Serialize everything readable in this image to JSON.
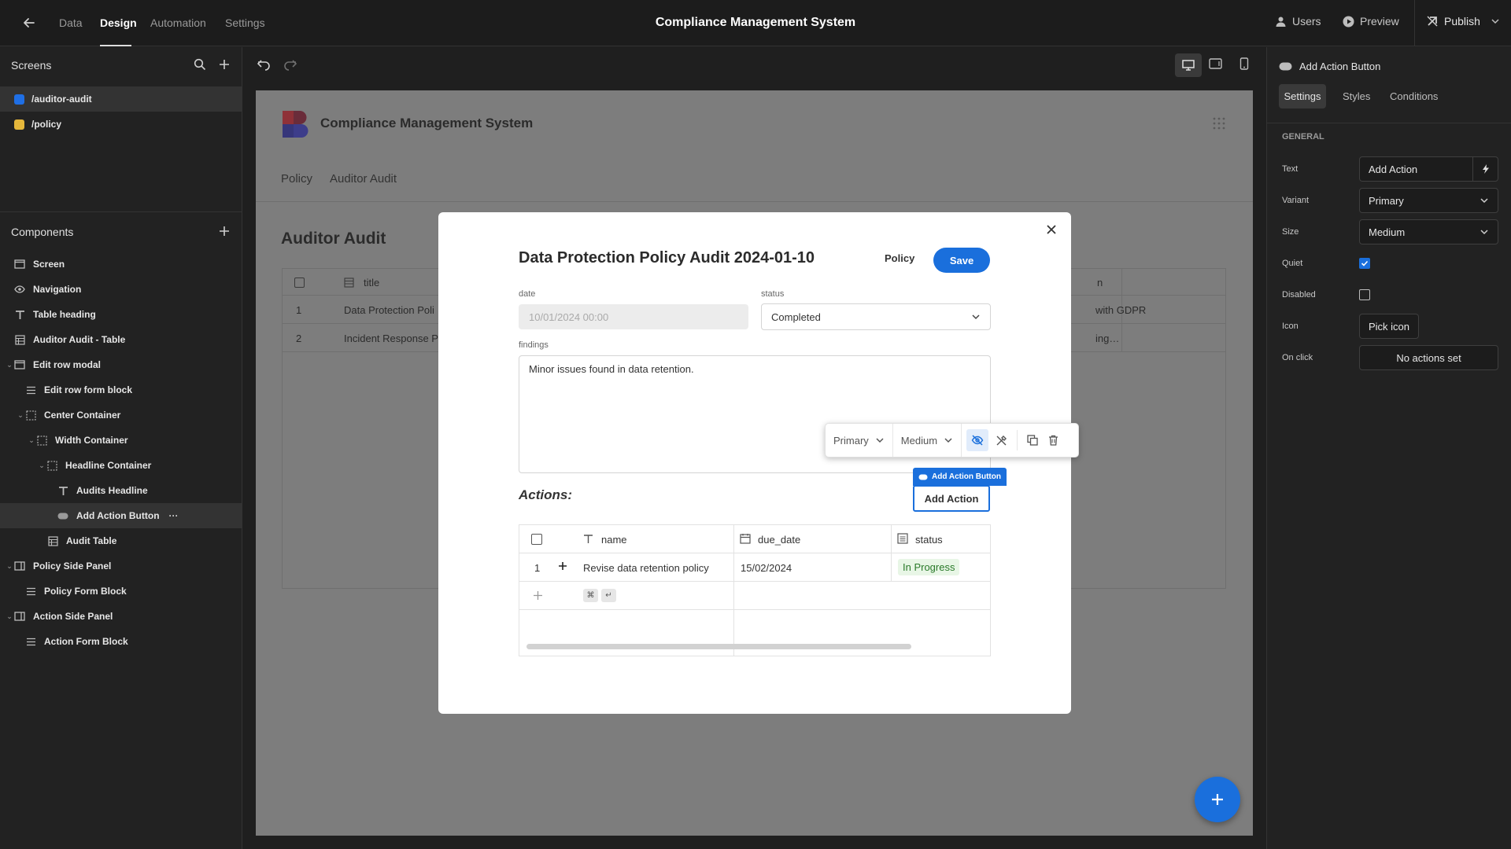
{
  "topbar": {
    "tabs": [
      {
        "label": "Data"
      },
      {
        "label": "Design"
      },
      {
        "label": "Automation"
      },
      {
        "label": "Settings"
      }
    ],
    "title": "Compliance Management System",
    "users_label": "Users",
    "preview_label": "Preview",
    "publish_label": "Publish"
  },
  "screens": {
    "header": "Screens",
    "items": [
      {
        "label": "/auditor-audit",
        "color": "#1f6fe5"
      },
      {
        "label": "/policy",
        "color": "#e5b73b"
      }
    ]
  },
  "components": {
    "header": "Components",
    "items": [
      {
        "label": "Screen",
        "icon": "screen-icon"
      },
      {
        "label": "Navigation",
        "icon": "eye-icon"
      },
      {
        "label": "Table heading",
        "icon": "text-icon"
      },
      {
        "label": "Auditor Audit - Table",
        "icon": "table-icon"
      },
      {
        "label": "Edit row modal",
        "icon": "modal-icon"
      },
      {
        "label": "Edit row form block",
        "icon": "form-icon"
      },
      {
        "label": "Center Container",
        "icon": "container-icon"
      },
      {
        "label": "Width Container",
        "icon": "container-icon"
      },
      {
        "label": "Headline Container",
        "icon": "container-icon"
      },
      {
        "label": "Audits Headline",
        "icon": "text-icon"
      },
      {
        "label": "Add Action Button",
        "icon": "button-icon"
      },
      {
        "label": "Audit Table",
        "icon": "table-icon"
      },
      {
        "label": "Policy Side Panel",
        "icon": "panel-icon"
      },
      {
        "label": "Policy Form Block",
        "icon": "form-icon"
      },
      {
        "label": "Action Side Panel",
        "icon": "panel-icon"
      },
      {
        "label": "Action Form Block",
        "icon": "form-icon"
      }
    ],
    "more_label": "···"
  },
  "app": {
    "title": "Compliance Management System",
    "nav": [
      "Policy",
      "Auditor Audit"
    ],
    "heading": "Auditor Audit",
    "table": {
      "col_title": "title",
      "col_partial": "n",
      "rows": [
        {
          "num": "1",
          "title": "Data Protection Poli",
          "right": "with GDPR"
        },
        {
          "num": "2",
          "title": "Incident Response P",
          "right": "ing…"
        }
      ]
    }
  },
  "modal": {
    "heading": "Data Protection Policy Audit 2024-01-10",
    "policy_label": "Policy",
    "save_label": "Save",
    "date_label": "date",
    "date_value": "10/01/2024 00:00",
    "status_label": "status",
    "status_value": "Completed",
    "findings_label": "findings",
    "findings_value": "Minor issues found in data retention.",
    "actions_heading": "Actions:",
    "add_action_tag": "Add Action Button",
    "add_action_label": "Add Action",
    "actions_table": {
      "columns": [
        "name",
        "due_date",
        "status"
      ],
      "rows": [
        {
          "num": "1",
          "name": "Revise data retention policy",
          "due_date": "15/02/2024",
          "status": "In Progress"
        }
      ],
      "new_row_keys": [
        "⌘",
        "↵"
      ]
    }
  },
  "toolbar": {
    "variant": "Primary",
    "size": "Medium"
  },
  "properties": {
    "component_name": "Add Action Button",
    "tabs": [
      "Settings",
      "Styles",
      "Conditions"
    ],
    "section": "GENERAL",
    "text_label": "Text",
    "text_value": "Add Action",
    "variant_label": "Variant",
    "variant_value": "Primary",
    "size_label": "Size",
    "size_value": "Medium",
    "quiet_label": "Quiet",
    "quiet_checked": true,
    "disabled_label": "Disabled",
    "disabled_checked": false,
    "icon_label": "Icon",
    "icon_button": "Pick icon",
    "onclick_label": "On click",
    "onclick_button": "No actions set"
  },
  "colors": {
    "accent": "#1a6fdc",
    "status_green_bg": "#e8f6e6",
    "status_green_text": "#2a7a2a",
    "logo_red": "#d9414f",
    "logo_blue": "#4f4fb3"
  }
}
